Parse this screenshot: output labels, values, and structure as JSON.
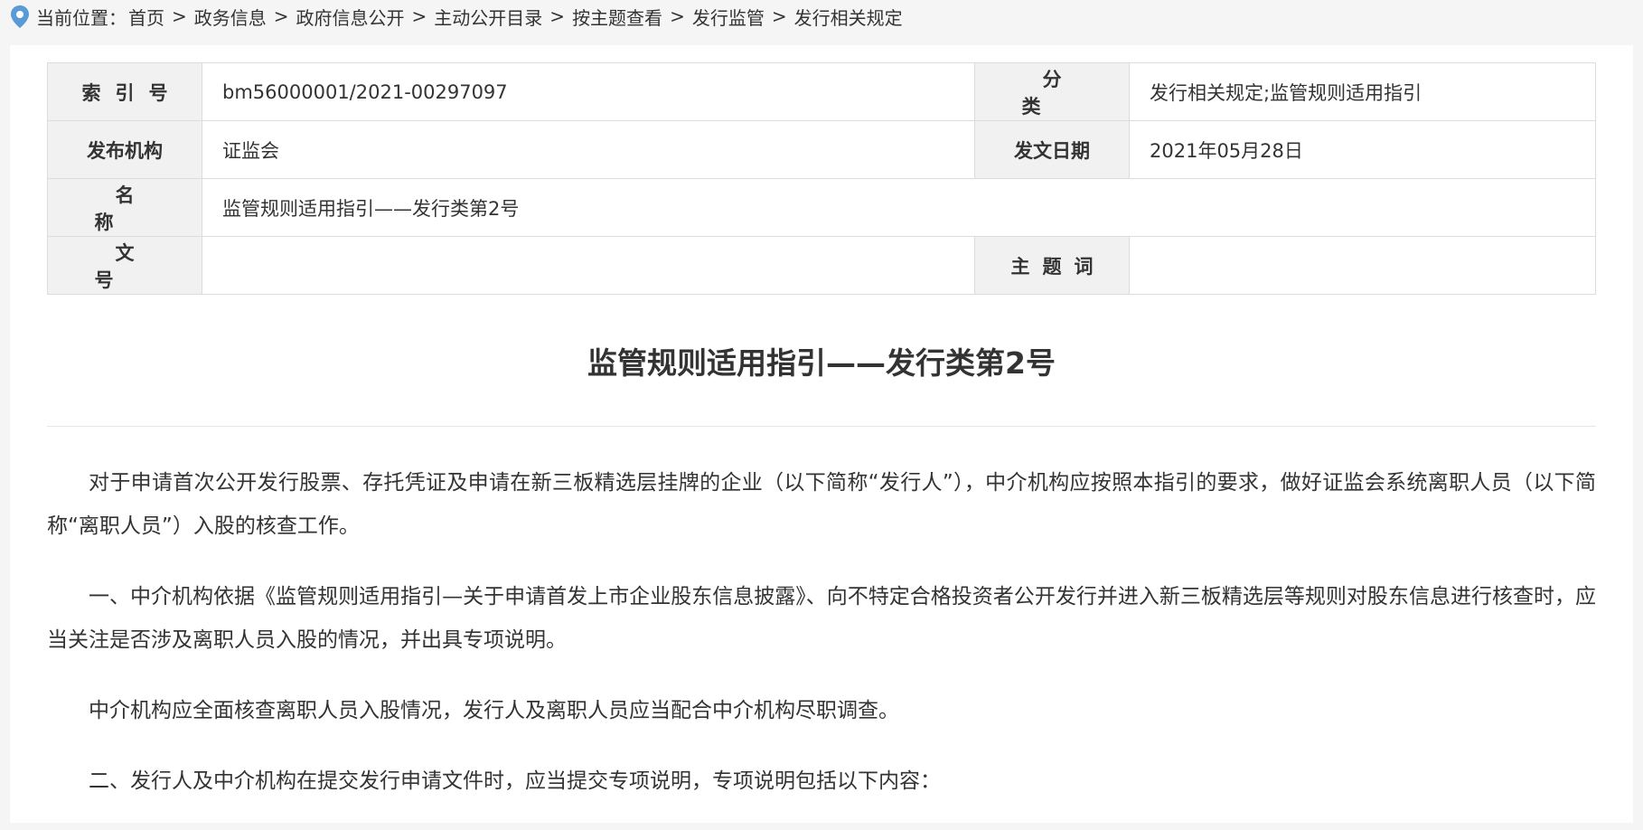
{
  "breadcrumb": {
    "prefix": "当前位置：",
    "items": [
      "首页",
      "政务信息",
      "政府信息公开",
      "主动公开目录",
      "按主题查看",
      "发行监管",
      "发行相关规定"
    ],
    "separator": ">"
  },
  "meta": {
    "index_label": "索引号",
    "index_value": "bm56000001/2021-00297097",
    "category_label": "分类",
    "category_value": "发行相关规定;监管规则适用指引",
    "issuer_label": "发布机构",
    "issuer_value": "证监会",
    "date_label": "发文日期",
    "date_value": "2021年05月28日",
    "name_label": "名称",
    "name_value": "监管规则适用指引——发行类第2号",
    "docno_label": "文号",
    "docno_value": "",
    "keywords_label": "主题词",
    "keywords_value": ""
  },
  "article": {
    "title": "监管规则适用指引——发行类第2号",
    "paragraphs": [
      "对于申请首次公开发行股票、存托凭证及申请在新三板精选层挂牌的企业（以下简称“发行人”），中介机构应按照本指引的要求，做好证监会系统离职人员（以下简称“离职人员”）入股的核查工作。",
      "一、中介机构依据《监管规则适用指引—关于申请首发上市企业股东信息披露》、向不特定合格投资者公开发行并进入新三板精选层等规则对股东信息进行核查时，应当关注是否涉及离职人员入股的情况，并出具专项说明。",
      "中介机构应全面核查离职人员入股情况，发行人及离职人员应当配合中介机构尽职调查。",
      "二、发行人及中介机构在提交发行申请文件时，应当提交专项说明，专项说明包括以下内容："
    ]
  },
  "colors": {
    "page_bg": "#f5f5f5",
    "label_bg": "#f1f1f1",
    "border": "#dcdcdc",
    "text": "#333333",
    "pin": "#5b9bd5"
  },
  "icons": {
    "location": "map-pin-icon"
  }
}
